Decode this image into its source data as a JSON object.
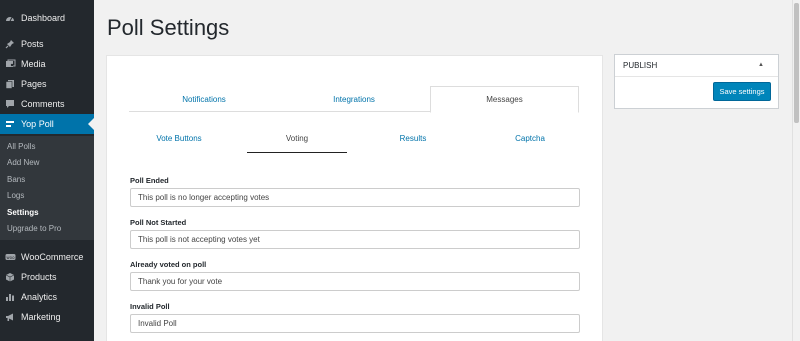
{
  "sidebar": {
    "items": [
      {
        "label": "Dashboard",
        "icon": "dashboard-icon"
      },
      {
        "label": "Posts",
        "icon": "pin-icon"
      },
      {
        "label": "Media",
        "icon": "media-icon"
      },
      {
        "label": "Pages",
        "icon": "pages-icon"
      },
      {
        "label": "Comments",
        "icon": "comment-icon"
      },
      {
        "label": "Yop Poll",
        "icon": "poll-icon"
      },
      {
        "label": "WooCommerce",
        "icon": "woo-icon"
      },
      {
        "label": "Products",
        "icon": "box-icon"
      },
      {
        "label": "Analytics",
        "icon": "bar-chart-icon"
      },
      {
        "label": "Marketing",
        "icon": "megaphone-icon"
      }
    ],
    "submenu": [
      "All Polls",
      "Add New",
      "Bans",
      "Logs",
      "Settings",
      "Upgrade to Pro"
    ]
  },
  "page_title": "Poll Settings",
  "tabs": [
    "Notifications",
    "Integrations",
    "Messages"
  ],
  "subtabs": [
    "Vote Buttons",
    "Voting",
    "Results",
    "Captcha"
  ],
  "fields": [
    {
      "label": "Poll Ended",
      "value": "This poll is no longer accepting votes"
    },
    {
      "label": "Poll Not Started",
      "value": "This poll is not accepting votes yet"
    },
    {
      "label": "Already voted on poll",
      "value": "Thank you for your vote"
    },
    {
      "label": "Invalid Poll",
      "value": "Invalid Poll"
    }
  ],
  "publish": {
    "title": "PUBLISH",
    "save_label": "Save settings"
  },
  "colors": {
    "sidebar_bg": "#23282d",
    "accent": "#0073aa",
    "button": "#0085ba"
  }
}
